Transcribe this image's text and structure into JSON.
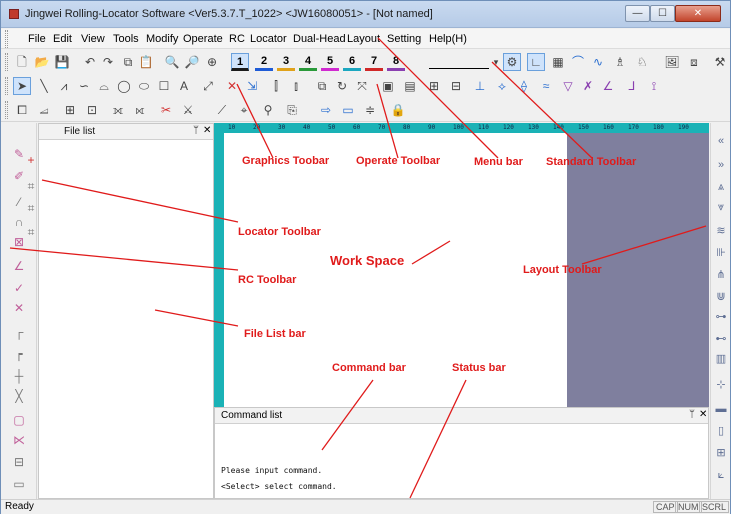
{
  "window": {
    "title": "Jingwei Rolling-Locator Software <Ver5.3.7.T_1022> <JW16080051> - [Not named]",
    "minimize_glyph": "—",
    "maximize_glyph": "☐",
    "close_glyph": "✕"
  },
  "menu": {
    "items": [
      "File",
      "Edit",
      "View",
      "Tools",
      "Modify",
      "Operate",
      "RC",
      "Locator",
      "Dual-Head",
      "Layout",
      "Setting",
      "Help(H)"
    ]
  },
  "layers": [
    "1",
    "2",
    "3",
    "4",
    "5",
    "6",
    "7",
    "8"
  ],
  "layer_colors": [
    "#1b1b1b",
    "#1e5bd6",
    "#e0a21a",
    "#2a9a3a",
    "#d02ad0",
    "#1ba7c0",
    "#d02828",
    "#8a3fb0"
  ],
  "file_list": {
    "title": "File list",
    "pin_glyph": "ᛘ",
    "close_glyph": "✕"
  },
  "ruler": {
    "labels": [
      "10",
      "20",
      "30",
      "40",
      "50",
      "60",
      "70",
      "80",
      "90",
      "100",
      "110",
      "120",
      "130",
      "140",
      "150",
      "160",
      "170",
      "180",
      "190"
    ]
  },
  "command_panel": {
    "title": "Command list",
    "pin_glyph": "ᛘ",
    "close_glyph": "✕",
    "lines": [
      "Please input command.",
      "<Select> select command."
    ]
  },
  "status": {
    "text": "Ready",
    "indicators": [
      "CAP",
      "NUM",
      "SCRL"
    ]
  },
  "annotations": {
    "graphics_toolbar": "Graphics Toobar",
    "operate_toolbar": "Operate Toolbar",
    "menu_bar": "Menu bar",
    "standard_toolbar": "Standard Toolbar",
    "locator_toolbar": "Locator Toolbar",
    "work_space": "Work Space",
    "rc_toolbar": "RC Toolbar",
    "layout_toolbar": "Layout Toolbar",
    "file_list_bar": "File List bar",
    "command_bar": "Command bar",
    "status_bar": "Status bar"
  },
  "colors": {
    "annotation": "#e01b1b",
    "ruler": "#1ab2b6",
    "workspace_bg": "#7f7f9e"
  }
}
